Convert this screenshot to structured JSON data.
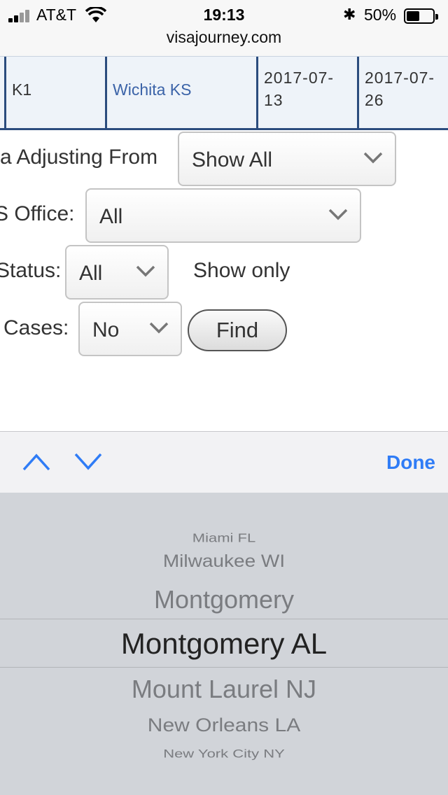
{
  "status_bar": {
    "carrier": "AT&T",
    "time": "19:13",
    "battery_percent": "50%",
    "battery_level": 0.5,
    "url": "visajourney.com",
    "icons": [
      "signal-icon",
      "wifi-icon",
      "bluetooth-icon",
      "battery-icon"
    ]
  },
  "table_row": {
    "visa": "K1",
    "office": "Wichita KS",
    "date1_line1": "2017-07-",
    "date1_line2": "13",
    "date2_line1": "2017-07-",
    "date2_line2": "26"
  },
  "form": {
    "adjusting_label": "a Adjusting From",
    "adjusting_value": "Show All",
    "office_label": "S Office:",
    "office_value": "All",
    "status_label": "Status:",
    "status_value": "All",
    "show_only": "Show only",
    "cases_label": "Cases:",
    "cases_value": "No",
    "find_button": "Find"
  },
  "accessory": {
    "done": "Done",
    "accent_color": "#2f7cf6"
  },
  "picker": {
    "items": [
      "Miami FL",
      "Milwaukee WI",
      "Montgomery",
      "Montgomery AL",
      "Mount Laurel NJ",
      "New Orleans LA",
      "New York City NY"
    ],
    "selected": "Montgomery AL"
  }
}
